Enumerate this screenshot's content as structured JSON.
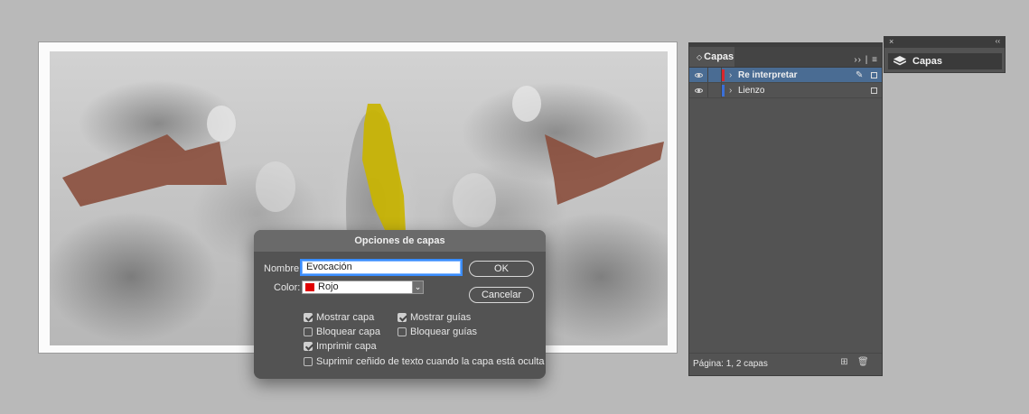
{
  "dialog": {
    "title": "Opciones de capas",
    "name_label": "Nombre:",
    "name_value": "Evocación",
    "color_label": "Color:",
    "color_value": "Rojo",
    "color_swatch": "#e00000",
    "ok_label": "OK",
    "cancel_label": "Cancelar",
    "options": [
      {
        "label": "Mostrar capa",
        "checked": true
      },
      {
        "label": "Mostrar guías",
        "checked": true
      },
      {
        "label": "Bloquear capa",
        "checked": false
      },
      {
        "label": "Bloquear guías",
        "checked": false
      },
      {
        "label": "Imprimir capa",
        "checked": true
      },
      {
        "label": "Suprimir ceñido de texto cuando la capa está oculta",
        "checked": false
      }
    ]
  },
  "layers_panel": {
    "tab_label": "Capas",
    "layers": [
      {
        "name": "Re interpretar",
        "color": "#d9272e",
        "selected": true
      },
      {
        "name": "Lienzo",
        "color": "#3a6fd8",
        "selected": false
      }
    ],
    "footer_text": "Página: 1, 2 capas",
    "new_layer_icon": "new-layer-icon",
    "delete_icon": "trash-icon"
  },
  "dock": {
    "item_label": "Capas",
    "icon": "layers-icon"
  },
  "colors": {
    "shape_brown": "#8a4e3c",
    "shape_yellow": "#c9b400",
    "selection_blue": "#4a6c93"
  }
}
